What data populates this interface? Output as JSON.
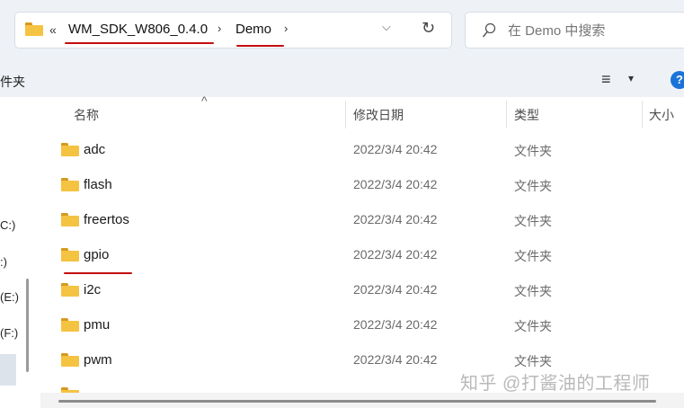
{
  "address_bar": {
    "overflow": "«",
    "crumbs": [
      "WM_SDK_W806_0.4.0",
      "Demo"
    ],
    "separator": "›",
    "dropdown": "⌵",
    "refresh": "↻"
  },
  "search": {
    "placeholder": "在 Demo 中搜索"
  },
  "toolbar": {
    "left_label": "件夹",
    "view_icon": "≡",
    "view_caret": "▾",
    "help": "?"
  },
  "sidebar": {
    "items": [
      "C:)",
      ":)",
      "(E:)",
      "(F:)"
    ],
    "sort_arrow": "^"
  },
  "columns": {
    "name": "名称",
    "date": "修改日期",
    "type": "类型",
    "size": "大小"
  },
  "files": [
    {
      "name": "adc",
      "date": "2022/3/4 20:42",
      "type": "文件夹"
    },
    {
      "name": "flash",
      "date": "2022/3/4 20:42",
      "type": "文件夹"
    },
    {
      "name": "freertos",
      "date": "2022/3/4 20:42",
      "type": "文件夹"
    },
    {
      "name": "gpio",
      "date": "2022/3/4 20:42",
      "type": "文件夹"
    },
    {
      "name": "i2c",
      "date": "2022/3/4 20:42",
      "type": "文件夹"
    },
    {
      "name": "pmu",
      "date": "2022/3/4 20:42",
      "type": "文件夹"
    },
    {
      "name": "pwm",
      "date": "2022/3/4 20:42",
      "type": "文件夹"
    }
  ],
  "watermark": "知乎 @打酱油的工程师",
  "colors": {
    "accent_underline": "#c40e0e",
    "folder": "#f5c342",
    "chrome": "#eef2f7",
    "help": "#1a73d9"
  }
}
